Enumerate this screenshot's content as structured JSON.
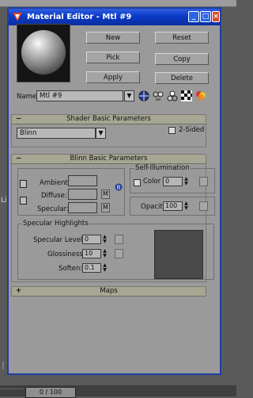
{
  "background": {
    "frame_counter": "0 / 100",
    "side_marker": "Li"
  },
  "window": {
    "title": "Material Editor - Mtl #9",
    "icons": {
      "app": "3dsmax-icon",
      "minimize": "minimize-icon",
      "maximize": "maximize-icon",
      "close": "close-icon"
    }
  },
  "buttons": {
    "new": "New",
    "reset": "Reset",
    "pick": "Pick",
    "copy": "Copy",
    "apply": "Apply",
    "delete": "Delete"
  },
  "name_row": {
    "label": "Name",
    "value": "Mtl #9",
    "tool_icons": [
      "globe-icon",
      "material-tree-icon",
      "material-tree-icon-2",
      "checker-icon",
      "color-wheel-icon"
    ]
  },
  "shader_panel": {
    "header": "Shader Basic Parameters",
    "toggle": "−",
    "shader_value": "Blinn",
    "two_sided_label": "2-Sided"
  },
  "blinn_panel": {
    "header": "Blinn Basic Parameters",
    "toggle": "−",
    "ambient_label": "Ambient:",
    "diffuse_label": "Diffuse:",
    "specular_label": "Specular:",
    "m_label": "M",
    "self_illum": {
      "title": "Self-Illumination",
      "color_label": "Color",
      "color_value": "0"
    },
    "opacity_label": "Opacity:",
    "opacity_value": "100",
    "highlights": {
      "title": "Specular Highlights",
      "level_label": "Specular Level:",
      "level_value": "0",
      "glossiness_label": "Glossiness:",
      "glossiness_value": "10",
      "soften_label": "Soften:",
      "soften_value": "0.1"
    }
  },
  "maps_panel": {
    "header": "Maps",
    "toggle": "+"
  },
  "colors": {
    "titlebar": "#0b3ac8",
    "rollout": "#a6a693",
    "panel_bg": "#9a9a9a"
  }
}
